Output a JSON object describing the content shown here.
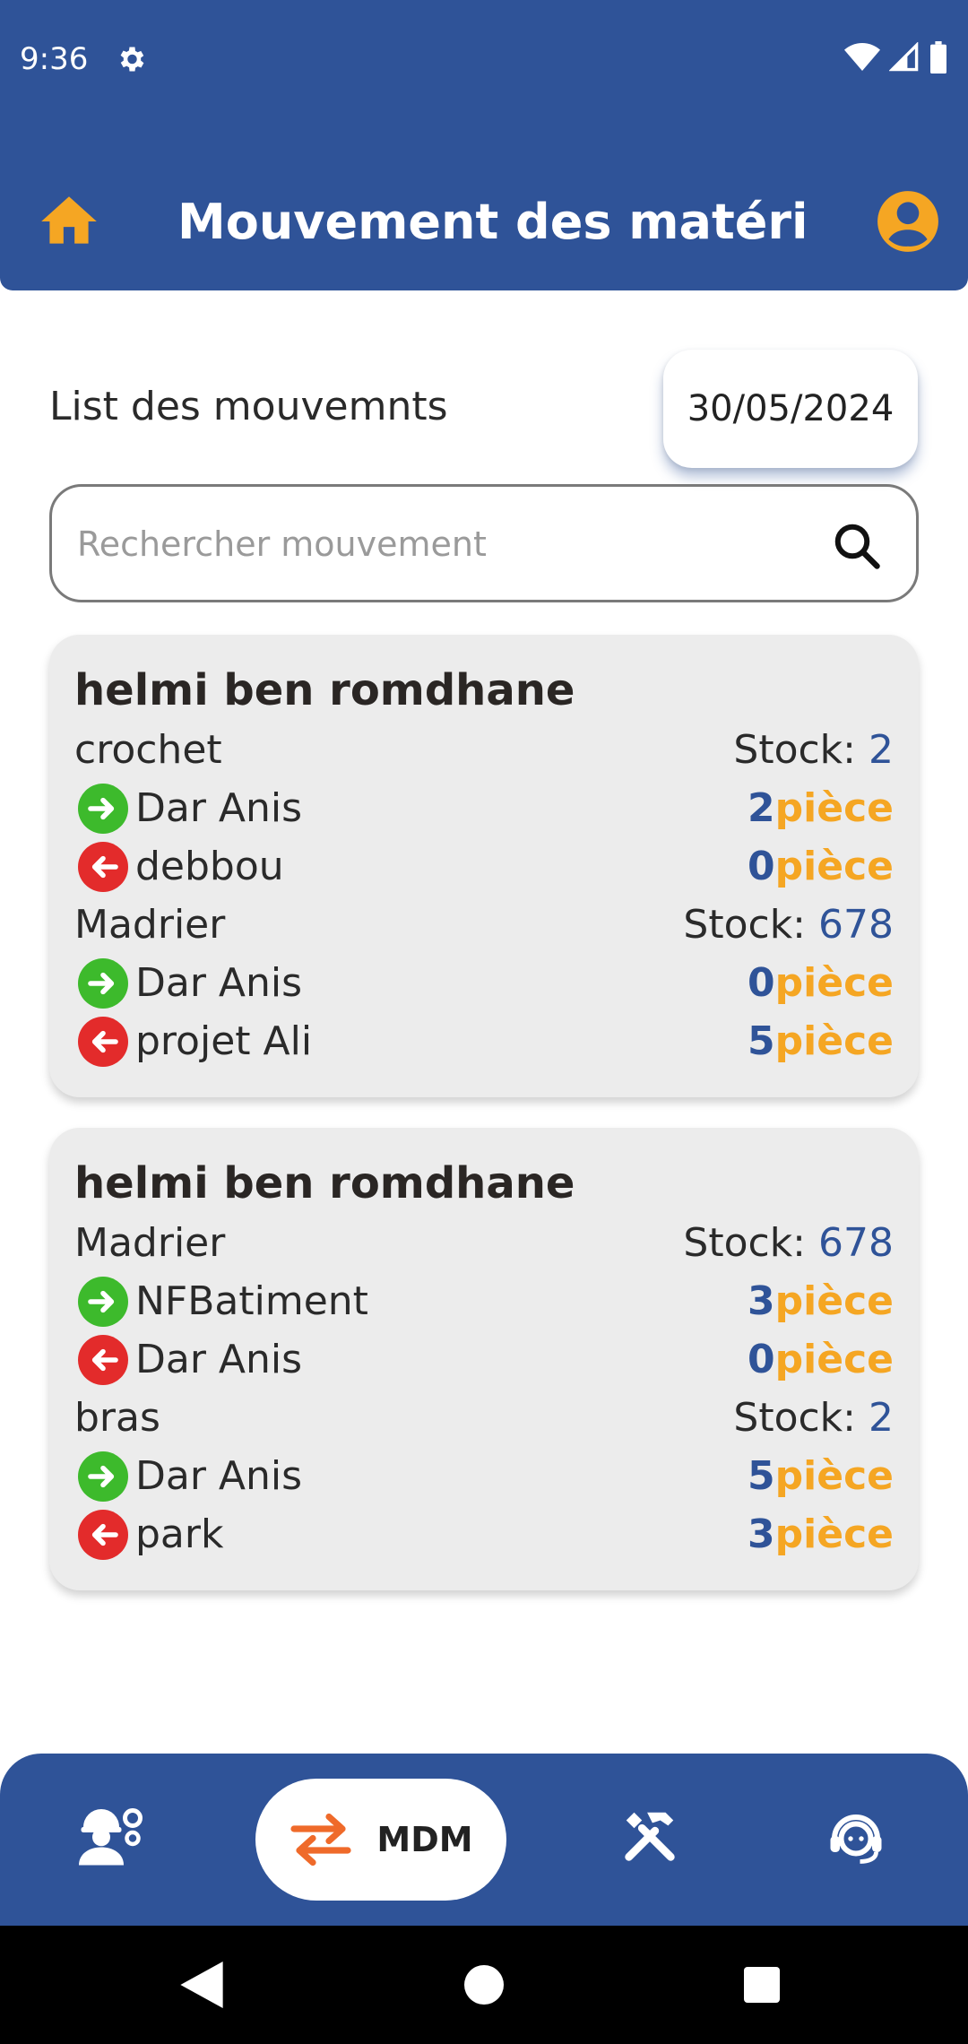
{
  "status_bar": {
    "time": "9:36"
  },
  "app_bar": {
    "title": "Mouvement des matéri..."
  },
  "section": {
    "title": "List des mouvemnts",
    "date": "30/05/2024"
  },
  "search": {
    "placeholder": "Rechercher mouvement",
    "value": ""
  },
  "colors": {
    "primary": "#2f5398",
    "accent": "#f5a623",
    "in": "#3dba2c",
    "out": "#e32b2b"
  },
  "cards": [
    {
      "user": "helmi ben romdhane",
      "materials": [
        {
          "name": "crochet",
          "stock_label": "Stock:",
          "stock": "2",
          "moves": [
            {
              "direction": "in",
              "place": "Dar Anis",
              "qty": "2",
              "unit": "pièce"
            },
            {
              "direction": "out",
              "place": "debbou",
              "qty": "0",
              "unit": "pièce"
            }
          ]
        },
        {
          "name": "Madrier",
          "stock_label": "Stock:",
          "stock": "678",
          "moves": [
            {
              "direction": "in",
              "place": "Dar Anis",
              "qty": "0",
              "unit": "pièce"
            },
            {
              "direction": "out",
              "place": "projet Ali",
              "qty": "5",
              "unit": "pièce"
            }
          ]
        }
      ]
    },
    {
      "user": "helmi ben romdhane",
      "materials": [
        {
          "name": "Madrier",
          "stock_label": "Stock:",
          "stock": "678",
          "moves": [
            {
              "direction": "in",
              "place": "NFBatiment",
              "qty": "3",
              "unit": "pièce"
            },
            {
              "direction": "out",
              "place": "Dar Anis",
              "qty": "0",
              "unit": "pièce"
            }
          ]
        },
        {
          "name": "bras",
          "stock_label": "Stock:",
          "stock": "2",
          "moves": [
            {
              "direction": "in",
              "place": "Dar Anis",
              "qty": "5",
              "unit": "pièce"
            },
            {
              "direction": "out",
              "place": "park",
              "qty": "3",
              "unit": "pièce"
            }
          ]
        }
      ]
    }
  ],
  "bottom_nav": {
    "items": [
      {
        "icon": "worker-settings-icon",
        "label": ""
      },
      {
        "icon": "swap-arrows-icon",
        "label": "MDM",
        "active": true
      },
      {
        "icon": "tools-icon",
        "label": ""
      },
      {
        "icon": "support-agent-icon",
        "label": ""
      }
    ]
  }
}
